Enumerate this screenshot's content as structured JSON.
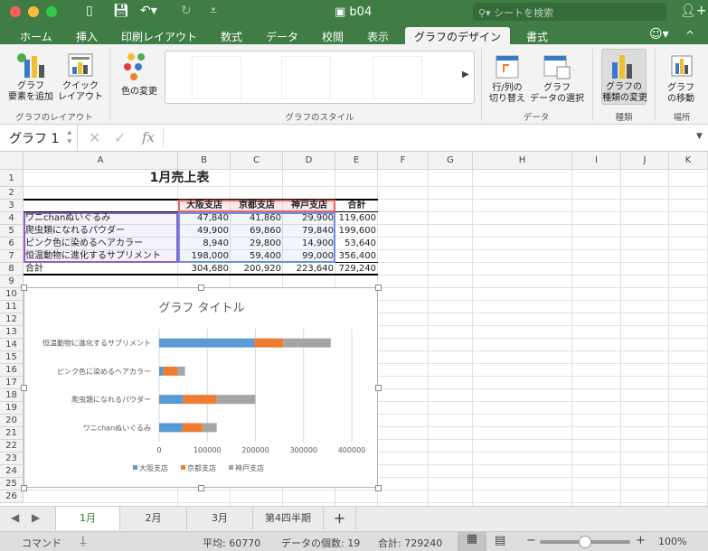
{
  "window": {
    "title": "b04",
    "search_placeholder": "シートを検索"
  },
  "ribbon_tabs": [
    {
      "label": "ホーム"
    },
    {
      "label": "挿入"
    },
    {
      "label": "印刷レイアウト"
    },
    {
      "label": "数式"
    },
    {
      "label": "データ"
    },
    {
      "label": "校閲"
    },
    {
      "label": "表示"
    },
    {
      "label": "グラフのデザイン",
      "active": true
    },
    {
      "label": "書式"
    }
  ],
  "ribbon": {
    "add_element": "グラフ\n要素を追加",
    "quick_layout": "クイック\nレイアウト",
    "layout_group": "グラフのレイアウト",
    "change_color": "色の変更",
    "style_group": "グラフのスタイル",
    "switch_rowcol": "行/列の\n切り替え",
    "select_data": "グラフ\nデータの選択",
    "data_group": "データ",
    "change_type": "グラフの\n種類の変更",
    "type_group": "種類",
    "move_chart": "グラフ\nの移動",
    "location_group": "場所"
  },
  "formula_bar": {
    "name_box": "グラフ 1",
    "fx": "fx",
    "value": ""
  },
  "columns": [
    "A",
    "B",
    "C",
    "D",
    "E",
    "F",
    "G",
    "H",
    "I",
    "J",
    "K"
  ],
  "rows": [
    "1",
    "2",
    "3",
    "4",
    "5",
    "6",
    "7",
    "8",
    "9",
    "10",
    "11",
    "12",
    "13",
    "14",
    "15",
    "16",
    "17",
    "18",
    "19",
    "20",
    "21",
    "22",
    "23",
    "24",
    "25",
    "26"
  ],
  "sheet": {
    "title": "1月売上表",
    "headers": [
      "大阪支店",
      "京都支店",
      "神戸支店",
      "合計"
    ],
    "data": [
      [
        "ワニchanぬいぐるみ",
        "47,840",
        "41,860",
        "29,900",
        "119,600"
      ],
      [
        "爬虫類になれるパウダー",
        "49,900",
        "69,860",
        "79,840",
        "199,600"
      ],
      [
        "ピンク色に染めるヘアカラー",
        "8,940",
        "29,800",
        "14,900",
        "53,640"
      ],
      [
        "恒温動物に進化するサプリメント",
        "198,000",
        "59,400",
        "99,000",
        "356,400"
      ]
    ],
    "total": [
      "合計",
      "304,680",
      "200,920",
      "223,640",
      "729,240"
    ]
  },
  "chart_data": {
    "type": "bar",
    "orientation": "horizontal",
    "stacked": true,
    "title": "グラフ タイトル",
    "categories": [
      "ワニchanぬいぐるみ",
      "爬虫類になれるパウダー",
      "ピンク色に染めるヘアカラー",
      "恒温動物に進化するサプリメント"
    ],
    "series": [
      {
        "name": "大阪支店",
        "values": [
          47840,
          49900,
          8940,
          198000
        ],
        "color": "#5b9bd5"
      },
      {
        "name": "京都支店",
        "values": [
          41860,
          69860,
          29800,
          59400
        ],
        "color": "#ed7d31"
      },
      {
        "name": "神戸支店",
        "values": [
          29900,
          79840,
          14900,
          99000
        ],
        "color": "#a5a5a5"
      }
    ],
    "xlim": [
      0,
      400000
    ],
    "xticks": [
      "0",
      "100000",
      "200000",
      "300000",
      "400000"
    ],
    "grid": true,
    "legend": "bottom"
  },
  "sheet_tabs": [
    {
      "label": "1月",
      "active": true
    },
    {
      "label": "2月"
    },
    {
      "label": "3月"
    },
    {
      "label": "第4四半期"
    }
  ],
  "status": {
    "mode": "コマンド",
    "average": "平均: 60770",
    "count": "データの個数: 19",
    "sum": "合計: 729240",
    "zoom": "100%",
    "zoom_level": 100
  },
  "colors": {
    "excel_green": "#3f7d45",
    "active_tab_text": "#2e7d32"
  }
}
